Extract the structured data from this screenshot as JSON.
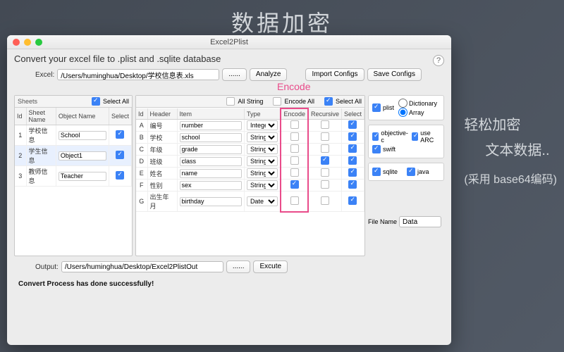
{
  "promo": {
    "title": "数据加密",
    "line1": "轻松加密",
    "line2": "文本数据..",
    "line3": "(采用 base64编码)"
  },
  "window": {
    "title": "Excel2Plist",
    "subtitle": "Convert your excel file to .plist and .sqlite database",
    "help": "?"
  },
  "top": {
    "excel_label": "Excel:",
    "excel_path": "/Users/huminghua/Desktop/学校信息表.xls",
    "browse": "......",
    "analyze": "Analyze",
    "import": "Import Configs",
    "save": "Save Configs"
  },
  "callout": "Encode",
  "sheets": {
    "title": "Sheets",
    "select_all": "Select All",
    "cols": {
      "id": "Id",
      "sheet": "Sheet Name",
      "object": "Object Name",
      "select": "Select"
    },
    "rows": [
      {
        "id": "1",
        "sheet": "学校信息",
        "object": "School",
        "select": true
      },
      {
        "id": "2",
        "sheet": "学生信息",
        "object": "Object1",
        "select": true
      },
      {
        "id": "3",
        "sheet": "教师信息",
        "object": "Teacher",
        "select": true
      }
    ]
  },
  "items": {
    "all_string": "All String",
    "encode_all": "Encode All",
    "select_all": "Select All",
    "cols": {
      "id": "Id",
      "header": "Header",
      "item": "Item",
      "type": "Type",
      "encode": "Encode",
      "recursive": "Recursive",
      "select": "Select"
    },
    "rows": [
      {
        "id": "A",
        "header": "编号",
        "item": "number",
        "type": "Integer",
        "encode": false,
        "recursive": false,
        "select": true
      },
      {
        "id": "B",
        "header": "学校",
        "item": "school",
        "type": "String",
        "encode": false,
        "recursive": false,
        "select": true
      },
      {
        "id": "C",
        "header": "年级",
        "item": "grade",
        "type": "String",
        "encode": false,
        "recursive": false,
        "select": true
      },
      {
        "id": "D",
        "header": "班级",
        "item": "class",
        "type": "String",
        "encode": false,
        "recursive": true,
        "select": true
      },
      {
        "id": "E",
        "header": "姓名",
        "item": "name",
        "type": "String",
        "encode": false,
        "recursive": false,
        "select": true
      },
      {
        "id": "F",
        "header": "性别",
        "item": "sex",
        "type": "String",
        "encode": true,
        "recursive": false,
        "select": true
      },
      {
        "id": "G",
        "header": "出生年月",
        "item": "birthday",
        "type": "Date",
        "encode": false,
        "recursive": false,
        "select": true
      }
    ]
  },
  "options": {
    "plist": {
      "label": "plist",
      "checked": true,
      "dict": "Dictionary",
      "array": "Array",
      "mode": "array"
    },
    "lang": {
      "objc": "objective-c",
      "objc_checked": true,
      "arc": "use ARC",
      "arc_checked": true,
      "swift": "swift",
      "swift_checked": true
    },
    "db": {
      "sqlite": "sqlite",
      "sqlite_checked": true,
      "java": "java",
      "java_checked": true
    },
    "filename_label": "File Name",
    "filename_value": "Data"
  },
  "bottom": {
    "output_label": "Output:",
    "output_path": "/Users/huminghua/Desktop/Excel2PlistOut",
    "browse": "......",
    "execute": "Excute"
  },
  "status": "Convert Process has done successfully!"
}
